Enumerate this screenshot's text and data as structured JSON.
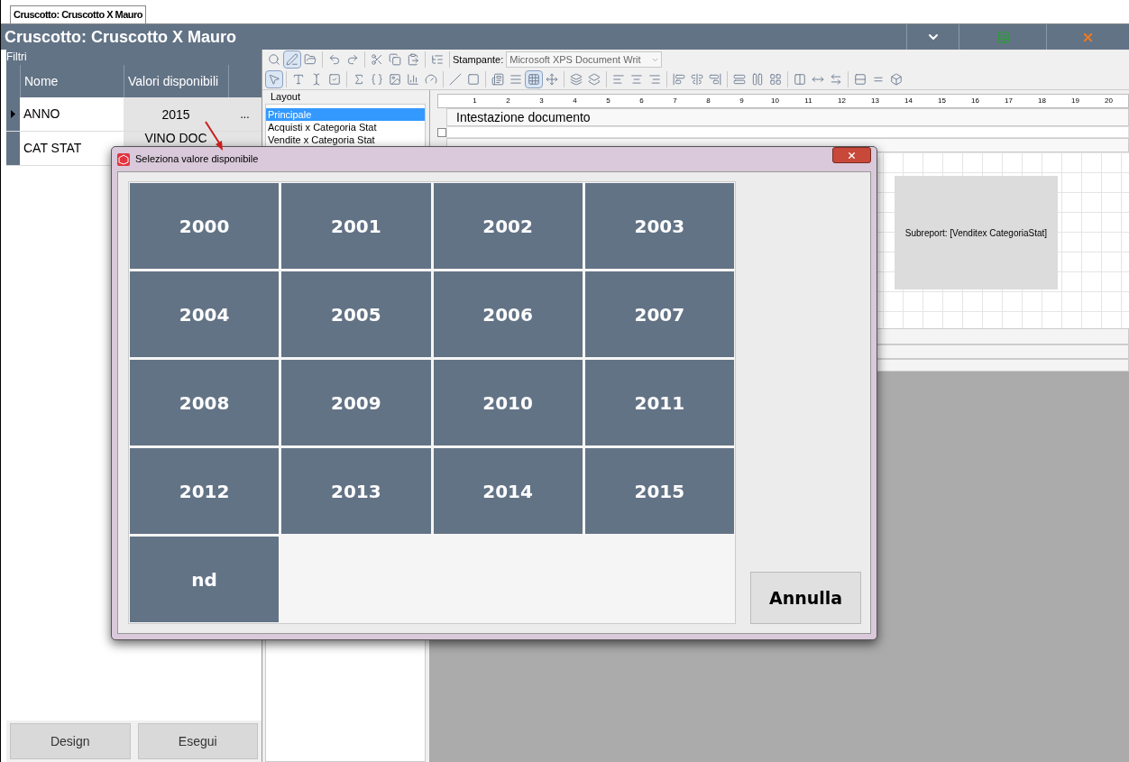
{
  "document_tab": {
    "label": "Cruscotto: Cruscotto X Mauro"
  },
  "header": {
    "title": "Cruscotto: Cruscotto X Mauro"
  },
  "filters": {
    "label": "Filtri",
    "columns": [
      "Nome",
      "Valori disponibili"
    ],
    "rows": [
      {
        "name": "ANNO",
        "value": "2015",
        "button": "...",
        "selected": true
      },
      {
        "name": "CAT STAT",
        "value": "VINO DOC",
        "selected": false
      }
    ]
  },
  "buttons": [
    "Design",
    "Esegui"
  ],
  "toolbar": {
    "printer_label": "Stampante:",
    "printer": "Microsoft XPS Document Writ"
  },
  "layouts": {
    "label": "Layout",
    "items": [
      {
        "label": "Principale",
        "selected": true
      },
      {
        "label": "Acquisti x Categoria Stat",
        "selected": false
      },
      {
        "label": "Vendite x Categoria Stat",
        "selected": false
      }
    ]
  },
  "ruler": [
    "1",
    "2",
    "3",
    "4",
    "5",
    "6",
    "7",
    "8",
    "9",
    "10",
    "11",
    "12",
    "13",
    "14",
    "15",
    "16",
    "17",
    "18",
    "19",
    "20"
  ],
  "bands": [
    "Intestazione documento"
  ],
  "band_checkbox": {
    "checked": false
  },
  "subreport": "Subreport: [Venditex CategoriaStat]",
  "dialog": {
    "title": "Seleziona valore disponibile",
    "values": [
      "2000",
      "2001",
      "2002",
      "2003",
      "2004",
      "2005",
      "2006",
      "2007",
      "2008",
      "2009",
      "2010",
      "2011",
      "2012",
      "2013",
      "2014",
      "2015",
      "nd"
    ],
    "cancel": "Annulla"
  }
}
